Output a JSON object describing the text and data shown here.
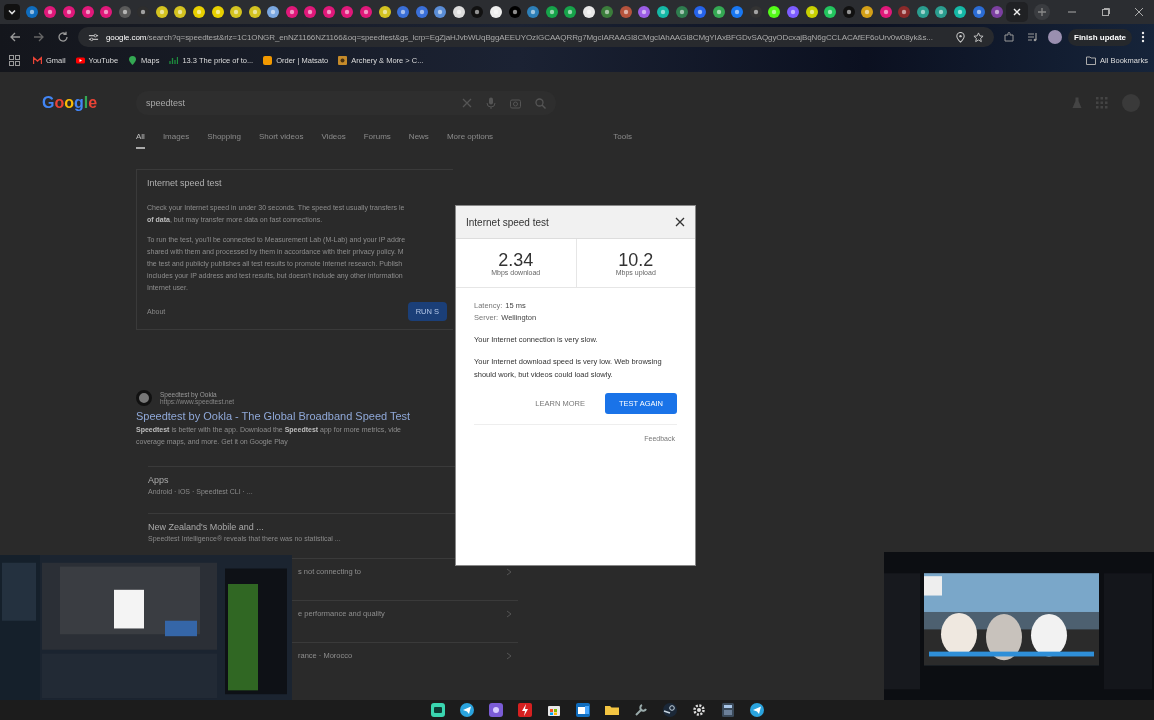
{
  "browser": {
    "tabs": [
      {
        "color": "#0f6cbd",
        "selected": false
      },
      {
        "color": "#e0187a",
        "selected": false
      },
      {
        "color": "#e0187a",
        "selected": false
      },
      {
        "color": "#e0187a",
        "selected": false
      },
      {
        "color": "#e0187a",
        "selected": false
      },
      {
        "color": "#5a5a5a",
        "selected": false
      },
      {
        "color": "#2e2e2e",
        "selected": false
      },
      {
        "color": "#d4c320",
        "selected": false
      },
      {
        "color": "#d4c320",
        "selected": false
      },
      {
        "color": "#e8d000",
        "selected": false
      },
      {
        "color": "#e8d000",
        "selected": false
      },
      {
        "color": "#d4c320",
        "selected": false
      },
      {
        "color": "#d4c320",
        "selected": false
      },
      {
        "color": "#7aa7e0",
        "selected": false
      },
      {
        "color": "#e0187a",
        "selected": false
      },
      {
        "color": "#e0187a",
        "selected": false
      },
      {
        "color": "#e0187a",
        "selected": false
      },
      {
        "color": "#e0187a",
        "selected": false
      },
      {
        "color": "#e0187a",
        "selected": false
      },
      {
        "color": "#d4c320",
        "selected": false
      },
      {
        "color": "#3a6fd8",
        "selected": false
      },
      {
        "color": "#3a6fd8",
        "selected": false
      },
      {
        "color": "#5a8dd6",
        "selected": false
      },
      {
        "color": "#dddddd",
        "selected": false
      },
      {
        "color": "#111111",
        "selected": false
      },
      {
        "color": "#eeeeee",
        "selected": false
      },
      {
        "color": "#000000",
        "selected": false
      },
      {
        "color": "#2d7fb8",
        "selected": false
      },
      {
        "color": "#16a34a",
        "selected": false
      },
      {
        "color": "#16a34a",
        "selected": false
      },
      {
        "color": "#e8e8e8",
        "selected": false
      },
      {
        "color": "#3b7d3b",
        "selected": false
      },
      {
        "color": "#b5533c",
        "selected": false
      },
      {
        "color": "#9b5de5",
        "selected": false
      },
      {
        "color": "#14b8a6",
        "selected": false
      },
      {
        "color": "#2f7d4f",
        "selected": false
      },
      {
        "color": "#2563eb",
        "selected": false
      },
      {
        "color": "#34a853",
        "selected": false
      },
      {
        "color": "#1877f2",
        "selected": false
      },
      {
        "color": "#333333",
        "selected": false
      },
      {
        "color": "#53fc18",
        "selected": false
      },
      {
        "color": "#7c5cff",
        "selected": false
      },
      {
        "color": "#c8d000",
        "selected": false
      },
      {
        "color": "#22c55e",
        "selected": false
      },
      {
        "color": "#111111",
        "selected": false
      },
      {
        "color": "#d4a017",
        "selected": false
      },
      {
        "color": "#e0187a",
        "selected": false
      },
      {
        "color": "#8b2a2a",
        "selected": false
      },
      {
        "color": "#2a9d8f",
        "selected": false
      },
      {
        "color": "#2a9d8f",
        "selected": false
      },
      {
        "color": "#14b8a6",
        "selected": false
      },
      {
        "color": "#2b6cd4",
        "selected": false
      },
      {
        "color": "#7b3fa0",
        "selected": false
      },
      {
        "color": "#202124",
        "selected": true
      }
    ],
    "address_host": "google.com",
    "address_path": "/search?q=speedtest&rlz=1C1ONGR_enNZ1166NZ1166&oq=speedtest&gs_lcrp=EgZjaHJvbWUqBggAEEUYOzIGCAAQRRg7MgcIARAAGI8CMgcIAhAAGI8CMgYIAxBFGDvSAQgyODcxajBqN6gCCLACAfEF6oUrv0w08yk&s...",
    "update_button": "Finish update",
    "bookmarks": [
      {
        "kind": "gmail",
        "label": "Gmail"
      },
      {
        "kind": "youtube",
        "label": "YouTube"
      },
      {
        "kind": "maps",
        "label": "Maps"
      },
      {
        "kind": "chart",
        "label": "13.3 The price of to..."
      },
      {
        "kind": "order",
        "label": "Order | Matsato"
      },
      {
        "kind": "archery",
        "label": "Archery & More > C..."
      }
    ],
    "all_bookmarks": "All Bookmarks"
  },
  "search_page": {
    "logo": "Google",
    "query": "speedtest",
    "tabs": [
      {
        "label": "All",
        "selected": true
      },
      {
        "label": "Images",
        "selected": false
      },
      {
        "label": "Shopping",
        "selected": false
      },
      {
        "label": "Short videos",
        "selected": false
      },
      {
        "label": "Videos",
        "selected": false
      },
      {
        "label": "Forums",
        "selected": false
      },
      {
        "label": "News",
        "selected": false
      },
      {
        "label": "More options",
        "selected": false
      }
    ],
    "tools": "Tools",
    "card": {
      "title": "Internet speed test",
      "lines": [
        "Check your Internet speed in under 30 seconds. The speed test usually transfers le",
        "**of data**, but may transfer more data on fast connections."
      ],
      "lines2": [
        "To run the test, you'll be connected to Measurement Lab (M-Lab) and your IP addre",
        "shared with them and processed by them in accordance with their privacy policy. M",
        "the test and publicly publishes all test results to promote Internet research. Publish",
        "includes your IP address and test results, but doesn't include any other information",
        "Internet user."
      ],
      "about": "About",
      "run_button": "RUN S"
    },
    "result": {
      "site": "Speedtest by Ookla",
      "url": "https://www.speedtest.net",
      "title": "Speedtest by Ookla - The Global Broadband Speed Test",
      "snippet": [
        "**Speedtest** is better with the app. Download the **Speedtest** app for more metrics, vide",
        "coverage maps, and more. Get it on Google Play"
      ],
      "sitelinks": [
        {
          "title": "Apps",
          "text": "Android · iOS · Speedtest CLI · ..."
        },
        {
          "title": "New Zealand's Mobile and ...",
          "text": "Speedtest Intelligence® reveals that there was no statistical ..."
        }
      ],
      "partial_links": [
        "s not connecting to",
        "e performance and quality",
        "rance · Morocco"
      ]
    }
  },
  "dialog": {
    "title": "Internet speed test",
    "results": [
      {
        "value": "2.34",
        "unit": "Mbps download"
      },
      {
        "value": "10.2",
        "unit": "Mbps upload"
      }
    ],
    "details": [
      {
        "label": "Latency:",
        "value": "15 ms"
      },
      {
        "label": "Server:",
        "value": "Wellington"
      }
    ],
    "messages": [
      "Your Internet connection is very slow.",
      "Your Internet download speed is very low. Web browsing should work, but videos could load slowly."
    ],
    "learn_more": "LEARN MORE",
    "test_again": "TEST AGAIN",
    "feedback": "Feedback"
  }
}
